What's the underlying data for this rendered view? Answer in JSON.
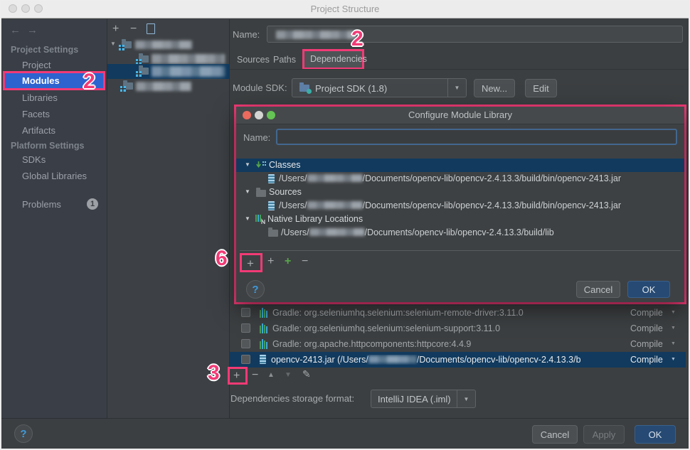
{
  "window": {
    "title": "Project Structure"
  },
  "icons": {
    "plus": "+",
    "minus": "−",
    "up_arrow": "▲",
    "down_arrow": "▼",
    "pencil": "✎",
    "help": "?",
    "back": "←",
    "forward": "→",
    "expand": "▼",
    "combo": "▼",
    "scope_arrow": "▼"
  },
  "sidebar": {
    "project_settings_header": "Project Settings",
    "items": {
      "project": "Project",
      "modules": "Modules",
      "libraries": "Libraries",
      "facets": "Facets",
      "artifacts": "Artifacts"
    },
    "platform_settings_header": "Platform Settings",
    "platform_items": {
      "sdks": "SDKs",
      "global_libraries": "Global Libraries"
    },
    "problems_label": "Problems",
    "problems_count": "1"
  },
  "module_editor": {
    "name_label": "Name:",
    "tabs": {
      "sources": "Sources",
      "paths": "Paths",
      "dependencies": "Dependencies"
    },
    "module_sdk_label": "Module SDK:",
    "module_sdk_value": "Project SDK (1.8)",
    "new_button": "New...",
    "edit_button": "Edit"
  },
  "library_dialog": {
    "title": "Configure Module Library",
    "name_label": "Name:",
    "classes_label": "Classes",
    "sources_label": "Sources",
    "native_label": "Native Library Locations",
    "path_prefix": "/Users/",
    "classes_path_suffix": "/Documents/opencv-lib/opencv-2.4.13.3/build/bin/opencv-2413.jar",
    "sources_path_suffix": "/Documents/opencv-lib/opencv-2.4.13.3/build/bin/opencv-2413.jar",
    "native_path_suffix": "/Documents/opencv-lib/opencv-2.4.13.3/build/lib",
    "cancel_button": "Cancel",
    "ok_button": "OK"
  },
  "dependencies": {
    "rows": [
      {
        "label": "Gradle: org.seleniumhq.selenium:selenium-remote-driver:3.11.0",
        "scope": "Compile"
      },
      {
        "label": "Gradle: org.seleniumhq.selenium:selenium-support:3.11.0",
        "scope": "Compile"
      },
      {
        "label": "Gradle: org.apache.httpcomponents:httpcore:4.4.9",
        "scope": "Compile"
      },
      {
        "label_prefix": "opencv-2413.jar (/Users/",
        "label_suffix": "/Documents/opencv-lib/opencv-2.4.13.3/b",
        "scope": "Compile"
      }
    ],
    "storage_format_label": "Dependencies storage format:",
    "storage_format_value": "IntelliJ IDEA (.iml)"
  },
  "footer": {
    "cancel_button": "Cancel",
    "apply_button": "Apply",
    "ok_button": "OK"
  },
  "annotations": {
    "modules_step": "2",
    "dependencies_step": "2",
    "dialog_add_step": "6",
    "deps_add_step": "3",
    "highlight_color": "#F23A76"
  }
}
